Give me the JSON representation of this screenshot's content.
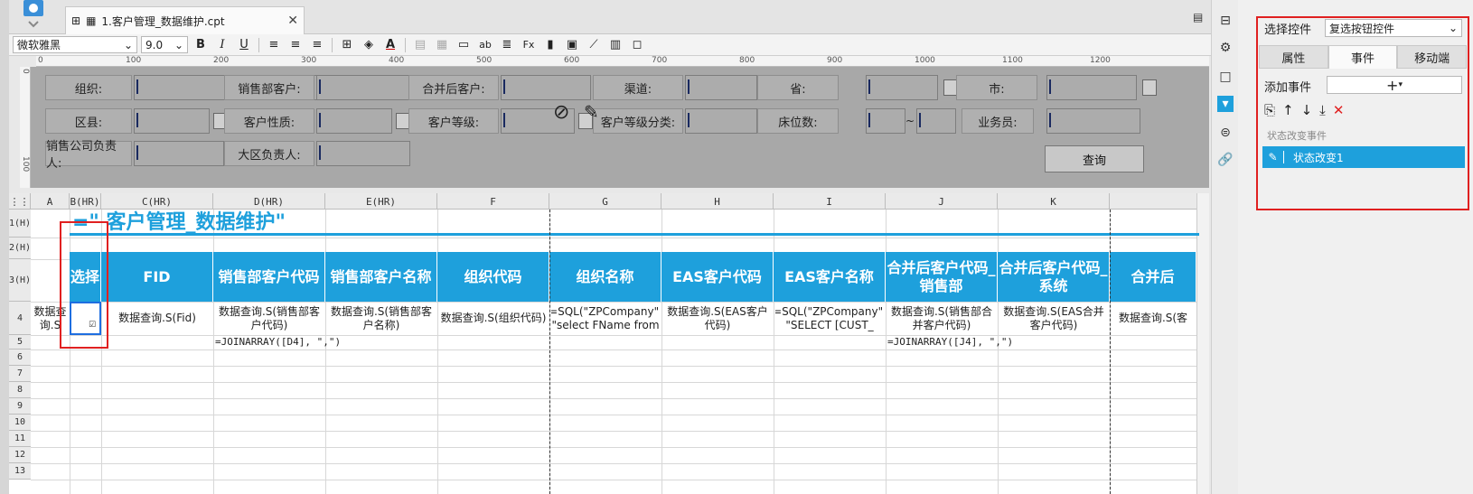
{
  "tab": {
    "title": "1.客户管理_数据维护.cpt"
  },
  "toolbar": {
    "font": "微软雅黑",
    "size": "9.0"
  },
  "ruler": {
    "h_ticks": [
      "0",
      "100",
      "200",
      "300",
      "400",
      "500",
      "600",
      "700",
      "800",
      "900",
      "1000",
      "1100",
      "1200"
    ],
    "v_ticks": [
      "0",
      "100"
    ]
  },
  "params": {
    "row1": [
      "组织:",
      "销售部客户:",
      "合并后客户:",
      "渠道:",
      "省:",
      "市:"
    ],
    "row2": [
      "区县:",
      "客户性质:",
      "客户等级:",
      "客户等级分类:",
      "床位数:",
      "业务员:"
    ],
    "row3": [
      "销售公司负责人:",
      "大区负责人:"
    ],
    "tilde": "~",
    "query": "查询"
  },
  "grid": {
    "columns": [
      "A",
      "B(HR)",
      "C(HR)",
      "D(HR)",
      "E(HR)",
      "F",
      "G",
      "H",
      "I",
      "J",
      "K"
    ],
    "rows": [
      "1(H)",
      "2(H)",
      "3(H)",
      "4",
      "5",
      "6",
      "7",
      "8",
      "9",
      "10",
      "11",
      "12",
      "13"
    ],
    "title": "=\"   客户管理_数据维护\"",
    "headers": [
      "选择",
      "FID",
      "销售部客户代码",
      "销售部客户名称",
      "组织代码",
      "组织名称",
      "EAS客户代码",
      "EAS客户名称",
      "合并后客户代码_销售部",
      "合并后客户代码_系统",
      "合并后"
    ],
    "row4": [
      "数据查询.S",
      "",
      "数据查询.S(Fid)",
      "数据查询.S(销售部客户代码)",
      "数据查询.S(销售部客户名称)",
      "数据查询.S(组织代码)",
      "=SQL(\"ZPCompany\", \"select FName from",
      "数据查询.S(EAS客户代码)",
      "=SQL(\"ZPCompany\", \"SELECT [CUST_",
      "数据查询.S(销售部合并客户代码)",
      "数据查询.S(EAS合并客户代码)",
      "数据查询.S(客"
    ],
    "row5_d": "=JOINARRAY([D4], \",\")",
    "row5_j": "=JOINARRAY([J4], \",\")"
  },
  "rpanel": {
    "select_label": "选择控件",
    "select_value": "复选按钮控件",
    "tabs": [
      "属性",
      "事件",
      "移动端"
    ],
    "add_event": "添加事件",
    "add_symbol": "+",
    "event_group": "状态改变事件",
    "event_item": "状态改变1"
  },
  "colors": {
    "accent": "#1ea0dc",
    "highlight": "#e02020"
  }
}
